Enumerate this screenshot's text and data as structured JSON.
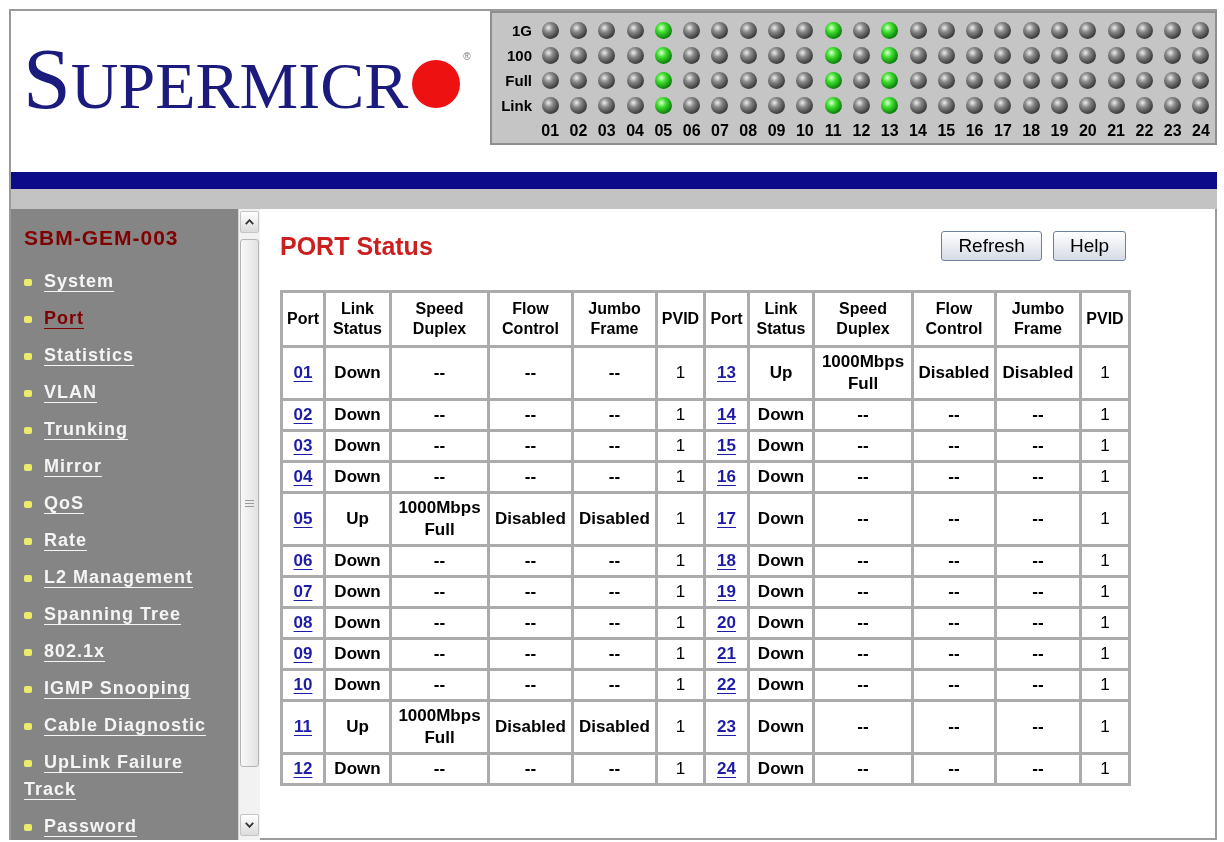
{
  "header": {
    "logo": {
      "text": "SUPERMICR",
      "mark": "®"
    },
    "led_panel": {
      "rows": [
        {
          "label": "1G",
          "leds": [
            {
              "on": false
            },
            {
              "on": false
            },
            {
              "on": false
            },
            {
              "on": false
            },
            {
              "on": true
            },
            {
              "on": false
            },
            {
              "on": false
            },
            {
              "on": false
            },
            {
              "on": false
            },
            {
              "on": false
            },
            {
              "on": true
            },
            {
              "on": false
            },
            {
              "on": true
            },
            {
              "on": false
            },
            {
              "on": false
            },
            {
              "on": false
            },
            {
              "on": false
            },
            {
              "on": false
            },
            {
              "on": false
            },
            {
              "on": false
            },
            {
              "on": false
            },
            {
              "on": false
            },
            {
              "on": false
            },
            {
              "on": false
            }
          ]
        },
        {
          "label": "100",
          "leds": [
            {
              "on": false
            },
            {
              "on": false
            },
            {
              "on": false
            },
            {
              "on": false
            },
            {
              "on": true
            },
            {
              "on": false
            },
            {
              "on": false
            },
            {
              "on": false
            },
            {
              "on": false
            },
            {
              "on": false
            },
            {
              "on": true
            },
            {
              "on": false
            },
            {
              "on": true
            },
            {
              "on": false
            },
            {
              "on": false
            },
            {
              "on": false
            },
            {
              "on": false
            },
            {
              "on": false
            },
            {
              "on": false
            },
            {
              "on": false
            },
            {
              "on": false
            },
            {
              "on": false
            },
            {
              "on": false
            },
            {
              "on": false
            }
          ]
        },
        {
          "label": "Full",
          "leds": [
            {
              "on": false
            },
            {
              "on": false
            },
            {
              "on": false
            },
            {
              "on": false
            },
            {
              "on": true
            },
            {
              "on": false
            },
            {
              "on": false
            },
            {
              "on": false
            },
            {
              "on": false
            },
            {
              "on": false
            },
            {
              "on": true
            },
            {
              "on": false
            },
            {
              "on": true
            },
            {
              "on": false
            },
            {
              "on": false
            },
            {
              "on": false
            },
            {
              "on": false
            },
            {
              "on": false
            },
            {
              "on": false
            },
            {
              "on": false
            },
            {
              "on": false
            },
            {
              "on": false
            },
            {
              "on": false
            },
            {
              "on": false
            }
          ]
        },
        {
          "label": "Link",
          "leds": [
            {
              "on": false
            },
            {
              "on": false
            },
            {
              "on": false
            },
            {
              "on": false
            },
            {
              "on": true
            },
            {
              "on": false
            },
            {
              "on": false
            },
            {
              "on": false
            },
            {
              "on": false
            },
            {
              "on": false
            },
            {
              "on": true
            },
            {
              "on": false
            },
            {
              "on": true
            },
            {
              "on": false
            },
            {
              "on": false
            },
            {
              "on": false
            },
            {
              "on": false
            },
            {
              "on": false
            },
            {
              "on": false
            },
            {
              "on": false
            },
            {
              "on": false
            },
            {
              "on": false
            },
            {
              "on": false
            },
            {
              "on": false
            }
          ]
        }
      ],
      "ports": [
        "01",
        "02",
        "03",
        "04",
        "05",
        "06",
        "07",
        "08",
        "09",
        "10",
        "11",
        "12",
        "13",
        "14",
        "15",
        "16",
        "17",
        "18",
        "19",
        "20",
        "21",
        "22",
        "23",
        "24"
      ]
    }
  },
  "sidebar": {
    "title": "SBM-GEM-003",
    "items": [
      {
        "label": "System",
        "selected": false
      },
      {
        "label": "Port",
        "selected": true
      },
      {
        "label": "Statistics",
        "selected": false
      },
      {
        "label": "VLAN",
        "selected": false
      },
      {
        "label": "Trunking",
        "selected": false
      },
      {
        "label": "Mirror",
        "selected": false
      },
      {
        "label": "QoS",
        "selected": false
      },
      {
        "label": "Rate",
        "selected": false
      },
      {
        "label": "L2 Management",
        "selected": false
      },
      {
        "label": "Spanning Tree",
        "selected": false
      },
      {
        "label": "802.1x",
        "selected": false
      },
      {
        "label": "IGMP Snooping",
        "selected": false
      },
      {
        "label": "Cable Diagnostic",
        "selected": false
      },
      {
        "label": "UpLink Failure Track",
        "selected": false
      },
      {
        "label": "Password",
        "selected": false
      }
    ]
  },
  "main": {
    "title": "PORT Status",
    "buttons": [
      "Refresh",
      "Help"
    ],
    "table": {
      "columns": [
        {
          "label": "Port",
          "kind": "link"
        },
        {
          "label": "Link Status",
          "kind": "text"
        },
        {
          "label": "Speed Duplex",
          "kind": "text"
        },
        {
          "label": "Flow Control",
          "kind": "text"
        },
        {
          "label": "Jumbo Frame",
          "kind": "text"
        },
        {
          "label": "PVID",
          "kind": "plain"
        },
        {
          "label": "Port",
          "kind": "link"
        },
        {
          "label": "Link Status",
          "kind": "text"
        },
        {
          "label": "Speed Duplex",
          "kind": "text"
        },
        {
          "label": "Flow Control",
          "kind": "text"
        },
        {
          "label": "Jumbo Frame",
          "kind": "text"
        },
        {
          "label": "PVID",
          "kind": "plain"
        }
      ],
      "rows": [
        {
          "cells": [
            "01",
            "Down",
            "--",
            "--",
            "--",
            "1",
            "13",
            "Up",
            "1000Mbps Full",
            "Disabled",
            "Disabled",
            "1"
          ]
        },
        {
          "cells": [
            "02",
            "Down",
            "--",
            "--",
            "--",
            "1",
            "14",
            "Down",
            "--",
            "--",
            "--",
            "1"
          ]
        },
        {
          "cells": [
            "03",
            "Down",
            "--",
            "--",
            "--",
            "1",
            "15",
            "Down",
            "--",
            "--",
            "--",
            "1"
          ]
        },
        {
          "cells": [
            "04",
            "Down",
            "--",
            "--",
            "--",
            "1",
            "16",
            "Down",
            "--",
            "--",
            "--",
            "1"
          ]
        },
        {
          "cells": [
            "05",
            "Up",
            "1000Mbps Full",
            "Disabled",
            "Disabled",
            "1",
            "17",
            "Down",
            "--",
            "--",
            "--",
            "1"
          ]
        },
        {
          "cells": [
            "06",
            "Down",
            "--",
            "--",
            "--",
            "1",
            "18",
            "Down",
            "--",
            "--",
            "--",
            "1"
          ]
        },
        {
          "cells": [
            "07",
            "Down",
            "--",
            "--",
            "--",
            "1",
            "19",
            "Down",
            "--",
            "--",
            "--",
            "1"
          ]
        },
        {
          "cells": [
            "08",
            "Down",
            "--",
            "--",
            "--",
            "1",
            "20",
            "Down",
            "--",
            "--",
            "--",
            "1"
          ]
        },
        {
          "cells": [
            "09",
            "Down",
            "--",
            "--",
            "--",
            "1",
            "21",
            "Down",
            "--",
            "--",
            "--",
            "1"
          ]
        },
        {
          "cells": [
            "10",
            "Down",
            "--",
            "--",
            "--",
            "1",
            "22",
            "Down",
            "--",
            "--",
            "--",
            "1"
          ]
        },
        {
          "cells": [
            "11",
            "Up",
            "1000Mbps Full",
            "Disabled",
            "Disabled",
            "1",
            "23",
            "Down",
            "--",
            "--",
            "--",
            "1"
          ]
        },
        {
          "cells": [
            "12",
            "Down",
            "--",
            "--",
            "--",
            "1",
            "24",
            "Down",
            "--",
            "--",
            "--",
            "1"
          ]
        }
      ]
    }
  }
}
